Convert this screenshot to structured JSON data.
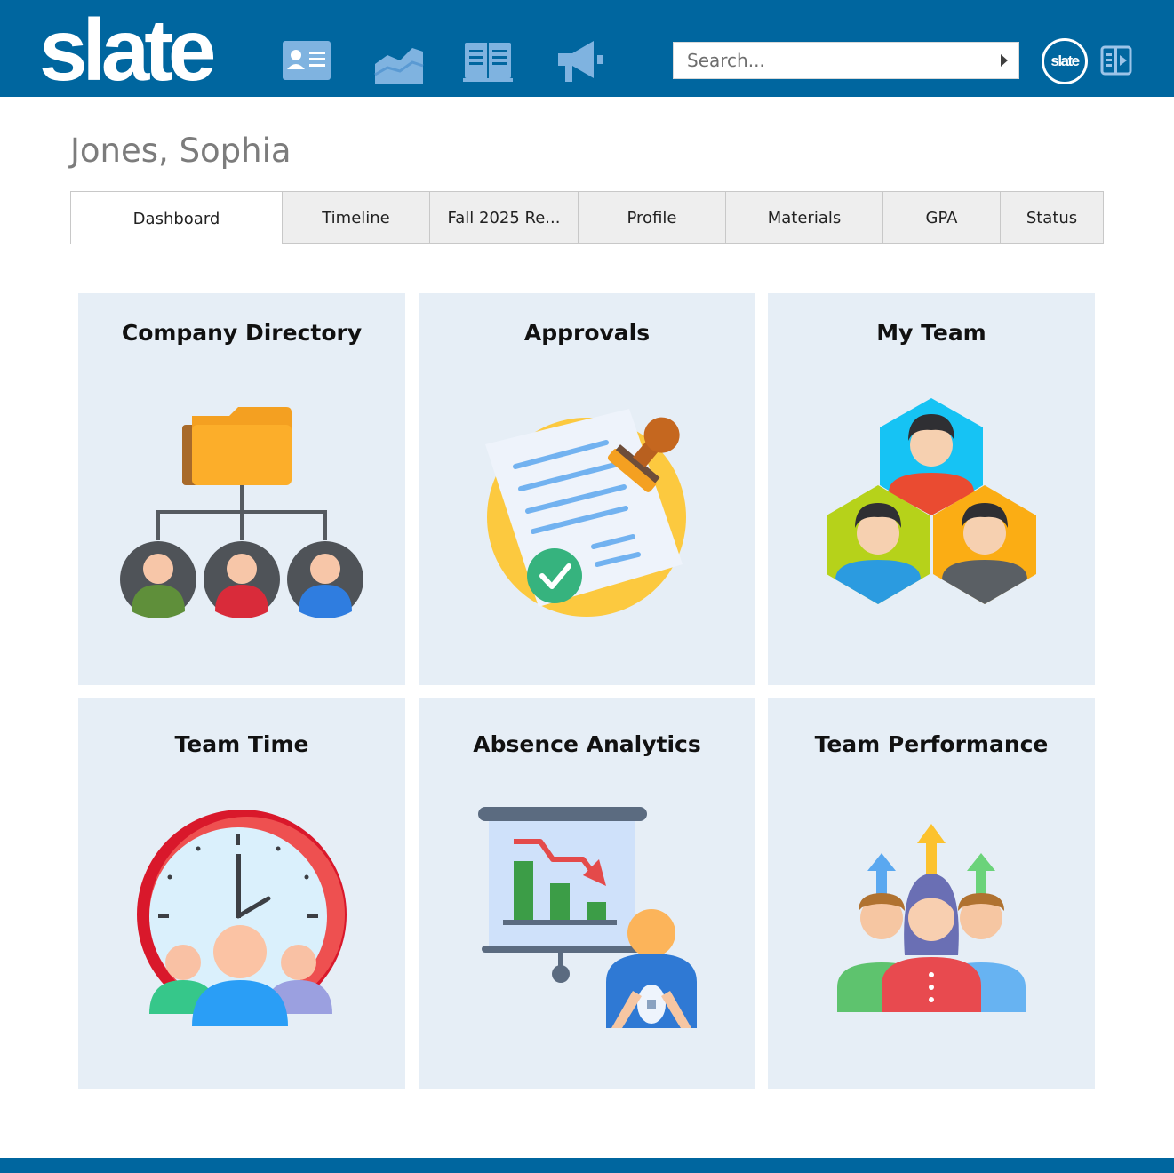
{
  "header": {
    "logo": "slate",
    "search_placeholder": "Search...",
    "badge": "slate",
    "nav_icons": [
      "contact-card-icon",
      "chart-icon",
      "book-icon",
      "megaphone-icon"
    ],
    "exit_icon": "exit-panel-icon"
  },
  "page": {
    "title": "Jones, Sophia"
  },
  "tabs": [
    {
      "label": "Dashboard",
      "active": true
    },
    {
      "label": "Timeline"
    },
    {
      "label": "Fall 2025 Re..."
    },
    {
      "label": "Profile"
    },
    {
      "label": "Materials"
    },
    {
      "label": "GPA"
    },
    {
      "label": "Status"
    }
  ],
  "cards": [
    {
      "title": "Company Directory",
      "icon": "org-chart-icon"
    },
    {
      "title": "Approvals",
      "icon": "approval-stamp-icon"
    },
    {
      "title": "My Team",
      "icon": "team-hexagon-icon"
    },
    {
      "title": "Team Time",
      "icon": "clock-team-icon"
    },
    {
      "title": "Absence Analytics",
      "icon": "presentation-chart-icon"
    },
    {
      "title": "Team Performance",
      "icon": "performance-arrows-icon"
    }
  ],
  "colors": {
    "brand": "#00669f",
    "card_bg": "#e6eef6",
    "tab_bg": "#eeeeee"
  }
}
